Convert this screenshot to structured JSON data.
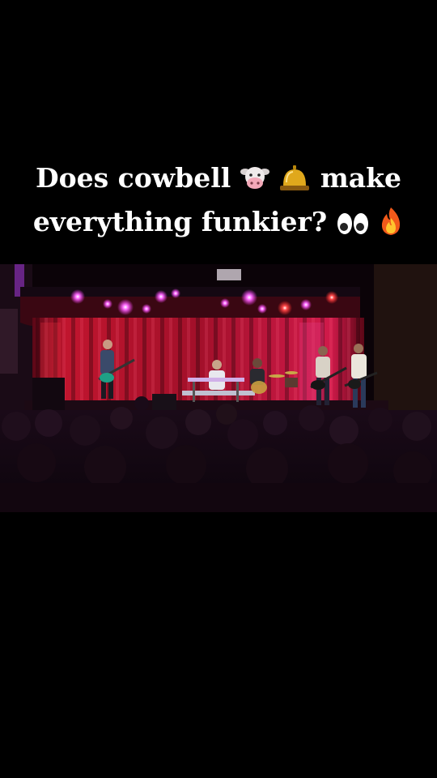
{
  "caption": {
    "line1_a": "Does cowbell",
    "line1_b": "make",
    "line2": "everything funkier?",
    "emoji": [
      "cow-face",
      "bell",
      "eyes",
      "fire"
    ]
  },
  "photo": {
    "subject": "band-on-stage"
  },
  "colors": {
    "background": "#000000",
    "curtain": "#b0102a",
    "light_magenta": "#ff3cff"
  }
}
